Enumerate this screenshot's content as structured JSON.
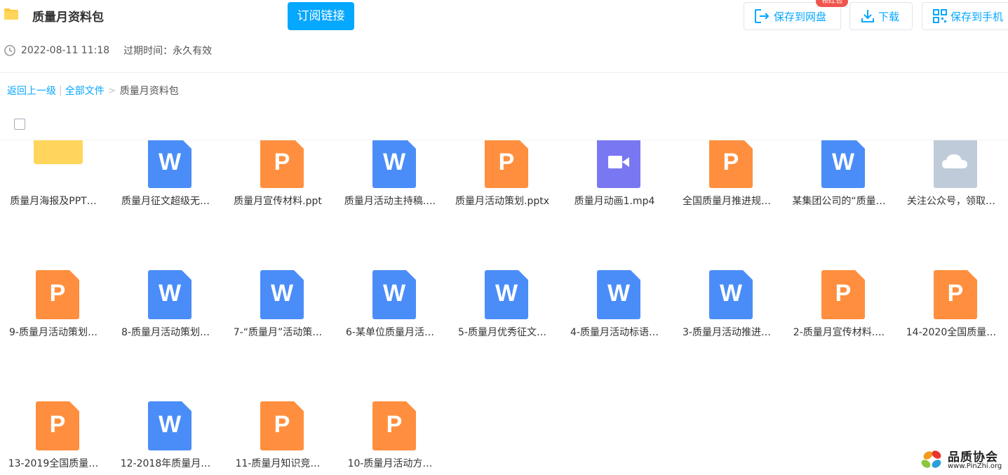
{
  "header": {
    "title": "质量月资料包",
    "subscribe_label": "订阅链接",
    "date": "2022-08-11 11:18",
    "expire_label": "过期时间：永久有效",
    "save_to_disk_label": "保存到网盘",
    "download_label": "下载",
    "save_to_phone_label": "保存到手机",
    "badge_label": "领红包",
    "accent_color": "#06a7ff",
    "badge_color": "#f0554d"
  },
  "breadcrumb": {
    "back": "返回上一级",
    "separator": "|",
    "all_files": "全部文件",
    "arrow": ">",
    "current": "质量月资料包"
  },
  "files": [
    {
      "name": "质量月海报及PPT…",
      "type": "folder",
      "icon": "folder-icon"
    },
    {
      "name": "质量月征文超级无…",
      "type": "word",
      "icon": "word-file-icon"
    },
    {
      "name": "质量月宣传材料.ppt",
      "type": "ppt",
      "icon": "ppt-file-icon"
    },
    {
      "name": "质量月活动主持稿.…",
      "type": "word",
      "icon": "word-file-icon"
    },
    {
      "name": "质量月活动策划.pptx",
      "type": "ppt",
      "icon": "ppt-file-icon"
    },
    {
      "name": "质量月动画1.mp4",
      "type": "video",
      "icon": "video-file-icon"
    },
    {
      "name": "全国质量月推进规…",
      "type": "ppt",
      "icon": "ppt-file-icon"
    },
    {
      "name": "某集团公司的“质量…",
      "type": "word",
      "icon": "word-file-icon"
    },
    {
      "name": "关注公众号，领取…",
      "type": "cloud",
      "icon": "cloud-file-icon"
    },
    {
      "name": "9-质量月活动策划…",
      "type": "ppt",
      "icon": "ppt-file-icon"
    },
    {
      "name": "8-质量月活动策划…",
      "type": "word",
      "icon": "word-file-icon"
    },
    {
      "name": "7-“质量月”活动策…",
      "type": "word",
      "icon": "word-file-icon"
    },
    {
      "name": "6-某单位质量月活…",
      "type": "word",
      "icon": "word-file-icon"
    },
    {
      "name": "5-质量月优秀征文…",
      "type": "word",
      "icon": "word-file-icon"
    },
    {
      "name": "4-质量月活动标语…",
      "type": "word",
      "icon": "word-file-icon"
    },
    {
      "name": "3-质量月活动推进…",
      "type": "word",
      "icon": "word-file-icon"
    },
    {
      "name": "2-质量月宣传材料.…",
      "type": "ppt",
      "icon": "ppt-file-icon"
    },
    {
      "name": "14-2020全国质量…",
      "type": "ppt",
      "icon": "ppt-file-icon"
    },
    {
      "name": "13-2019全国质量…",
      "type": "ppt",
      "icon": "ppt-file-icon"
    },
    {
      "name": "12-2018年质量月…",
      "type": "word",
      "icon": "word-file-icon"
    },
    {
      "name": "11-质量月知识竞…",
      "type": "ppt",
      "icon": "ppt-file-icon"
    },
    {
      "name": "10-质量月活动方…",
      "type": "ppt",
      "icon": "ppt-file-icon"
    }
  ],
  "icon_letters": {
    "word": "W",
    "ppt": "P"
  },
  "colors": {
    "word": "#4a8df8",
    "ppt": "#ff8f3e",
    "video": "#7a77f2",
    "folder": "#ffd65b",
    "cloud": "#bfcbd8"
  },
  "watermark": {
    "title": "品质协会",
    "url": "www.PinZhi.org"
  }
}
